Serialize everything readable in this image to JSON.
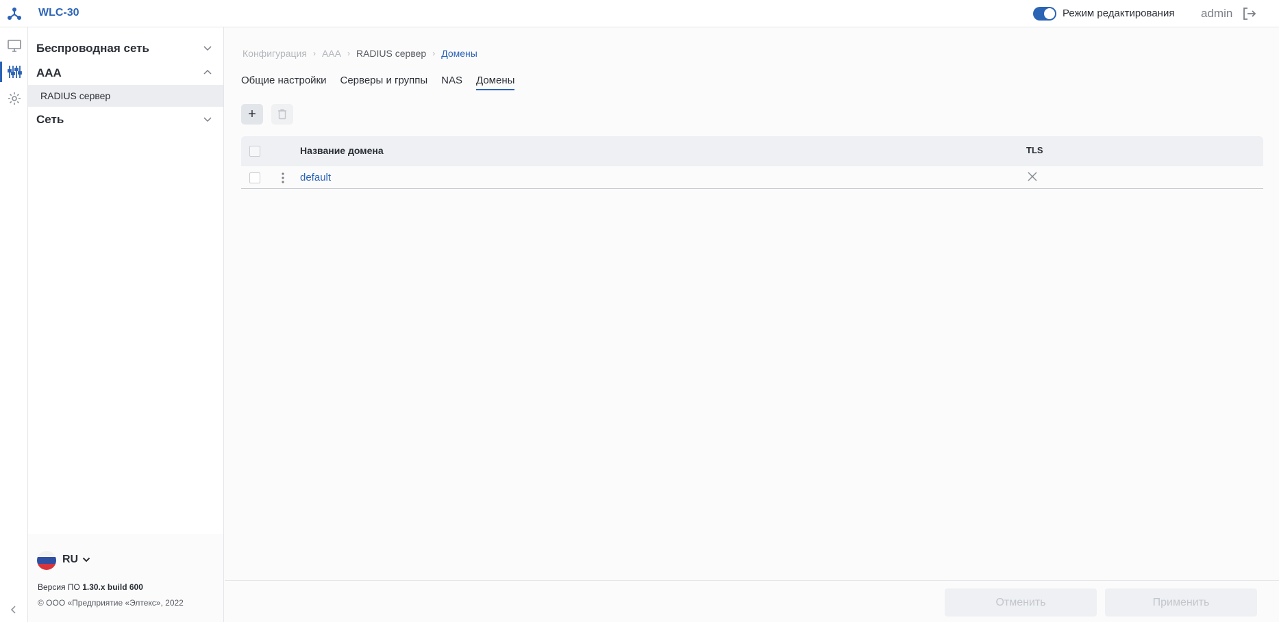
{
  "app": {
    "title": "WLC-30"
  },
  "header": {
    "edit_mode_label": "Режим редактирования",
    "edit_mode_on": true,
    "user": "admin"
  },
  "rail": {
    "icons": [
      "monitor-icon",
      "sliders-icon",
      "gear-icon"
    ],
    "active": "sliders-icon"
  },
  "sidebar": {
    "groups": [
      {
        "label": "Беспроводная сеть",
        "expanded": false
      },
      {
        "label": "AAA",
        "expanded": true,
        "items": [
          {
            "label": "RADIUS сервер",
            "selected": true
          }
        ]
      },
      {
        "label": "Сеть",
        "expanded": false
      }
    ],
    "footer": {
      "lang": "RU",
      "version_prefix": "Версия ПО ",
      "version": "1.30.x build 600",
      "copyright": "© ООО «Предприятие «Элтекс», 2022"
    }
  },
  "breadcrumb": [
    "Конфигурация",
    "AAA",
    "RADIUS сервер",
    "Домены"
  ],
  "tabs": [
    {
      "label": "Общие настройки",
      "active": false
    },
    {
      "label": "Серверы и группы",
      "active": false
    },
    {
      "label": "NAS",
      "active": false
    },
    {
      "label": "Домены",
      "active": true
    }
  ],
  "toolbar": {
    "add_label": "+"
  },
  "table": {
    "columns": [
      "Название домена",
      "TLS"
    ],
    "rows": [
      {
        "name": "default",
        "tls": false
      }
    ]
  },
  "footer_buttons": {
    "cancel": "Отменить",
    "apply": "Применить"
  },
  "colors": {
    "accent": "#2b63b5",
    "text": "#2b2f36",
    "muted": "#b3b7bd",
    "disabled_bg": "#eef0f3"
  }
}
